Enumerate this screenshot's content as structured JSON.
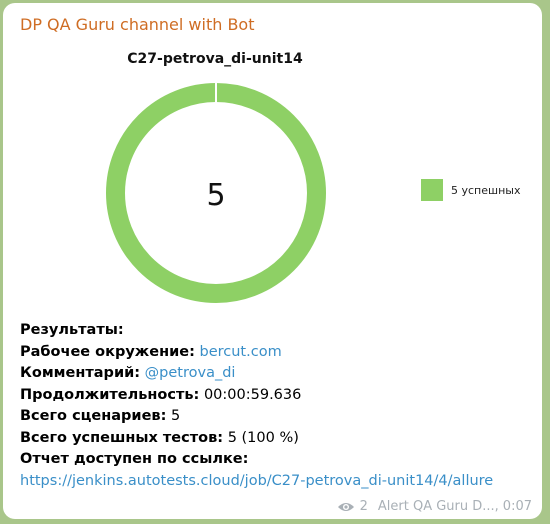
{
  "channel": {
    "name": "DP QA Guru channel with Bot",
    "name_color": "#cf6d24"
  },
  "chart": {
    "title": "C27-petrova_di-unit14",
    "center_label": "5",
    "legend_label": "5 успешных",
    "ring_color": "#8ed065"
  },
  "chart_data": {
    "type": "pie",
    "title": "C27-petrova_di-unit14",
    "categories": [
      "5 успешных"
    ],
    "values": [
      5
    ],
    "colors": [
      "#8ed065"
    ],
    "center_text": "5",
    "legend_placement": "right"
  },
  "message": {
    "results_label": "Результаты:",
    "env_label": "Рабочее окружение:",
    "env_value": "bercut.com",
    "comment_label": "Комментарий:",
    "comment_value": "@petrova_di",
    "duration_label": "Продолжительность:",
    "duration_value": "00:00:59.636",
    "scenarios_label": "Всего сценариев:",
    "scenarios_value": "5",
    "passed_label": "Всего успешных тестов:",
    "passed_value": "5 (100 %)",
    "report_label": "Отчет доступен по ссылке:",
    "report_url": "https://jenkins.autotests.cloud/job/C27-petrova_di-unit14/4/allure",
    "link_color": "#3a8fc8"
  },
  "meta": {
    "views": "2",
    "signature": "Alert QA Guru D...,",
    "time": "0:07",
    "icon": "eye-icon"
  }
}
